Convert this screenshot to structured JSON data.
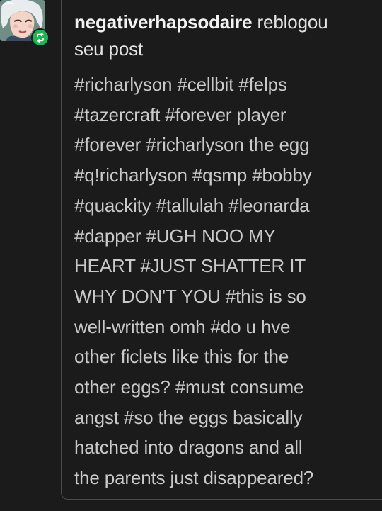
{
  "notification": {
    "username": "negativerhapsodaire",
    "action_line1": " reblogou",
    "action_line2": "seu post"
  },
  "avatar": {
    "icon": "character-avatar",
    "badge_icon": "reblog-icon",
    "badge_color": "#1fb555"
  },
  "tags": {
    "lines": [
      "#richarlyson #cellbit #felps",
      "#tazercraft #forever player",
      "#forever #richarlyson the egg",
      "#q!richarlyson #qsmp #bobby",
      "#quackity #tallulah #leonarda",
      "#dapper #UGH NOO MY",
      "HEART #JUST SHATTER IT",
      "WHY DON'T YOU #this is so",
      "well-written omh #do u hve",
      "other ficlets like this for the",
      "other eggs? #must consume",
      "angst #so the eggs basically",
      "hatched into dragons and all",
      "the parents just disappeared?"
    ]
  }
}
